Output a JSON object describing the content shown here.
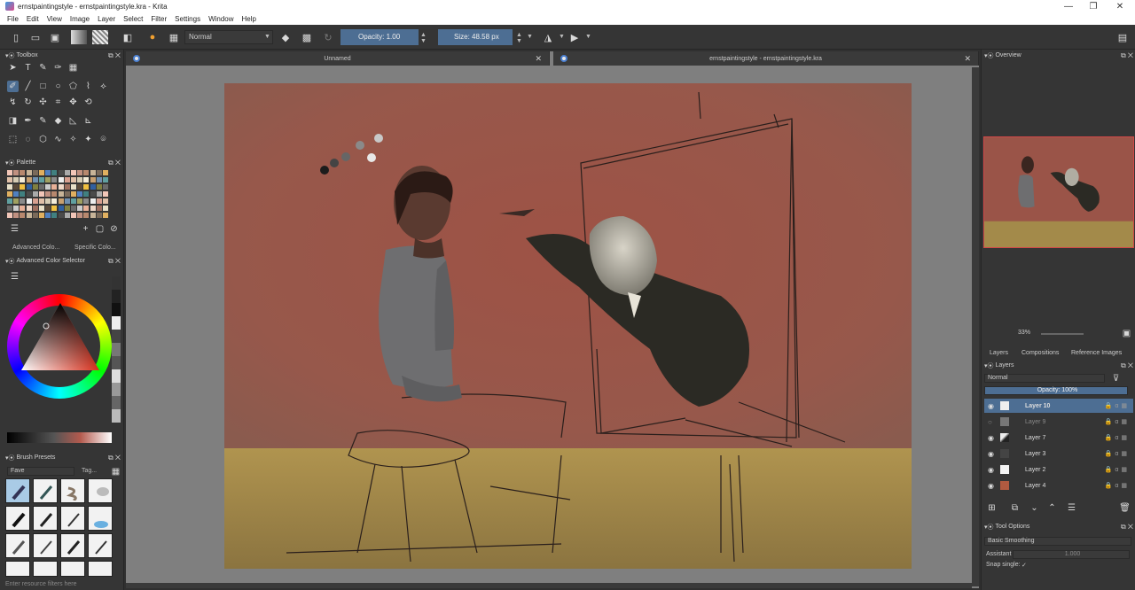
{
  "window": {
    "title": "ernstpaintingstyle - ernstpaintingstyle.kra  - Krita",
    "controls": [
      "—",
      "❐",
      "✕"
    ]
  },
  "menu": [
    "File",
    "Edit",
    "View",
    "Image",
    "Layer",
    "Select",
    "Filter",
    "Settings",
    "Window",
    "Help"
  ],
  "toolbar": {
    "blend_mode": "Normal",
    "opacity_label": "Opacity:  1.00",
    "size_label": "Size:  48.58 px"
  },
  "toolbox": {
    "title": "Toolbox"
  },
  "palette": {
    "title": "Palette",
    "tabs": [
      "Advanced Colo...",
      "Specific Colo..."
    ]
  },
  "color_selector": {
    "title": "Advanced Color Selector"
  },
  "brush_presets": {
    "title": "Brush Presets",
    "filter": "Fave",
    "tag_label": "Tag...",
    "search_placeholder": "Enter resource filters here"
  },
  "documents": {
    "tabs": [
      {
        "label": "Unnamed"
      },
      {
        "label": "ernstpaintingstyle - ernstpaintingstyle.kra"
      }
    ]
  },
  "overview": {
    "title": "Overview",
    "zoom": "33%"
  },
  "layers_panel": {
    "tabs": [
      "Layers",
      "Compositions",
      "Reference Images"
    ],
    "title": "Layers",
    "blend_mode": "Normal",
    "opacity_label": "Opacity:  100%",
    "layers": [
      {
        "name": "Layer 10",
        "selected": true,
        "visible": true
      },
      {
        "name": "Layer 9",
        "selected": false,
        "visible": false
      },
      {
        "name": "Layer 7",
        "selected": false,
        "visible": true
      },
      {
        "name": "Layer 3",
        "selected": false,
        "visible": true
      },
      {
        "name": "Layer 2",
        "selected": false,
        "visible": true
      },
      {
        "name": "Layer 4",
        "selected": false,
        "visible": true
      }
    ]
  },
  "tool_options": {
    "title": "Tool Options",
    "smoothing": "Basic Smoothing",
    "assistant_label": "Assistant",
    "assistant_value": "1.000",
    "snap_label": "Snap single:",
    "snap_check": "✓"
  },
  "colors": {
    "accent": "#4d6e93",
    "wall": "#9a5448",
    "floor": "#a38a4a"
  }
}
